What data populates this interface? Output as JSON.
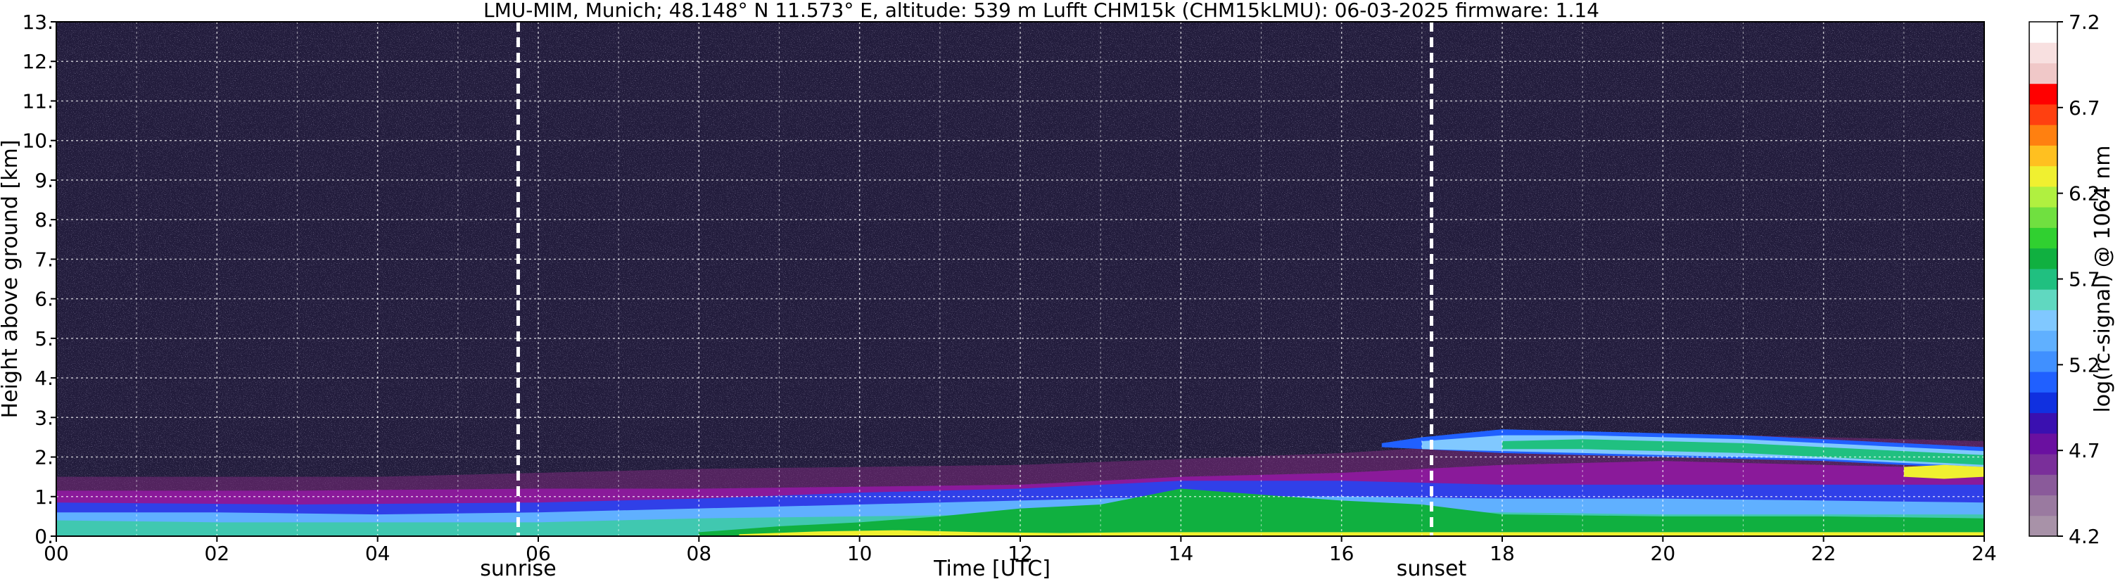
{
  "chart_data": {
    "type": "heatmap",
    "title": "LMU-MIM, Munich; 48.148° N 11.573° E, altitude: 539 m    Lufft CHM15k (CHM15kLMU): 06-03-2025    firmware: 1.14",
    "xlabel": "Time [UTC]",
    "ylabel": "Height above ground [km]",
    "xlim": [
      0,
      24
    ],
    "ylim": [
      0,
      13
    ],
    "x_ticks": [
      "00",
      "02",
      "04",
      "06",
      "08",
      "10",
      "12",
      "14",
      "16",
      "18",
      "20",
      "22",
      "24"
    ],
    "x_tick_values": [
      0,
      2,
      4,
      6,
      8,
      10,
      12,
      14,
      16,
      18,
      20,
      22,
      24
    ],
    "y_ticks": [
      "0.",
      "1.",
      "2.",
      "3.",
      "4.",
      "5.",
      "6.",
      "7.",
      "8.",
      "9.",
      "10.",
      "11.",
      "12.",
      "13."
    ],
    "y_tick_values": [
      0,
      1,
      2,
      3,
      4,
      5,
      6,
      7,
      8,
      9,
      10,
      11,
      12,
      13
    ],
    "grid": true,
    "background_color": "#221c3c",
    "colorbar": {
      "label": "log(rc-signal) @ 1064 nm",
      "range": [
        4.2,
        7.2
      ],
      "ticks": [
        "4.2",
        "4.7",
        "5.2",
        "5.7",
        "6.2",
        "6.7",
        "7.2"
      ],
      "tick_values": [
        4.2,
        4.7,
        5.2,
        5.7,
        6.2,
        6.7,
        7.2
      ],
      "colors": [
        "#a892a8",
        "#9a7aa0",
        "#8a5a9a",
        "#7a2f9a",
        "#6a10a0",
        "#3a10b0",
        "#1030e0",
        "#2060ff",
        "#4090ff",
        "#60b0ff",
        "#80c8ff",
        "#60d8c0",
        "#20c080",
        "#10b040",
        "#30d030",
        "#70e040",
        "#b0f040",
        "#f0f030",
        "#ffc020",
        "#ff8010",
        "#ff4010",
        "#ff0000",
        "#f0c8c8",
        "#f8e0e0",
        "#ffffff"
      ]
    },
    "events": [
      {
        "name": "sunrise",
        "time": 5.75
      },
      {
        "name": "sunset",
        "time": 17.12
      }
    ],
    "layers": [
      {
        "name": "noise-haze",
        "color": "#7a2a7a",
        "opacity": 0.55,
        "x": [
          0,
          4,
          8,
          12,
          16,
          20,
          24
        ],
        "bottom": [
          0,
          0,
          0,
          0,
          0,
          0,
          0
        ],
        "top": [
          1.5,
          1.5,
          1.7,
          1.8,
          2.1,
          2.6,
          2.4
        ]
      },
      {
        "name": "residual-layer",
        "color": "#8a1a9a",
        "opacity": 1,
        "x": [
          0,
          3,
          6,
          8,
          10,
          12,
          14,
          16,
          18,
          20,
          22,
          24
        ],
        "bottom": [
          0.7,
          0.7,
          0.7,
          0.8,
          1.0,
          1.0,
          1.0,
          1.0,
          1.0,
          1.0,
          1.0,
          1.0
        ],
        "top": [
          1.15,
          1.15,
          1.2,
          1.2,
          1.25,
          1.3,
          1.5,
          1.6,
          1.8,
          1.9,
          1.8,
          1.7
        ]
      },
      {
        "name": "mixing-blue",
        "color": "#3040e8",
        "opacity": 1,
        "x": [
          0,
          3,
          6,
          8,
          10,
          12,
          14,
          16,
          18,
          20,
          22,
          24
        ],
        "bottom": [
          0.35,
          0.35,
          0.35,
          0.4,
          0.4,
          0.5,
          0.6,
          0.6,
          0.6,
          0.6,
          0.6,
          0.6
        ],
        "top": [
          0.85,
          0.8,
          0.85,
          0.95,
          1.1,
          1.2,
          1.4,
          1.4,
          1.3,
          1.3,
          1.3,
          1.3
        ]
      },
      {
        "name": "aerosol-lightblue",
        "color": "#60b0ff",
        "opacity": 1,
        "x": [
          0,
          2,
          4,
          6,
          8,
          10,
          12,
          14,
          16,
          18,
          20,
          22,
          24
        ],
        "bottom": [
          0.25,
          0.25,
          0.25,
          0.25,
          0.25,
          0.3,
          0.35,
          0.4,
          0.4,
          0.4,
          0.4,
          0.4,
          0.4
        ],
        "top": [
          0.6,
          0.6,
          0.55,
          0.6,
          0.7,
          0.8,
          0.9,
          1.0,
          1.0,
          0.95,
          0.95,
          0.9,
          0.85
        ]
      },
      {
        "name": "surface-teal",
        "color": "#40c8b0",
        "opacity": 1,
        "x": [
          0,
          2,
          4,
          6,
          8,
          10,
          12,
          14,
          16,
          18,
          20,
          22,
          24
        ],
        "bottom": [
          0,
          0,
          0,
          0,
          0,
          0,
          0,
          0,
          0,
          0,
          0,
          0,
          0
        ],
        "top": [
          0.4,
          0.35,
          0.35,
          0.35,
          0.45,
          0.5,
          0.55,
          0.6,
          0.6,
          0.6,
          0.55,
          0.55,
          0.55
        ]
      },
      {
        "name": "growth-green",
        "color": "#10b040",
        "opacity": 1,
        "x": [
          8,
          9,
          10,
          11,
          12,
          13,
          14,
          15,
          16,
          17,
          18,
          20,
          22,
          24
        ],
        "bottom": [
          0,
          0,
          0,
          0,
          0,
          0,
          0,
          0,
          0,
          0,
          0,
          0,
          0,
          0
        ],
        "top": [
          0.1,
          0.25,
          0.35,
          0.5,
          0.7,
          0.8,
          1.2,
          1.05,
          0.9,
          0.8,
          0.55,
          0.5,
          0.5,
          0.45
        ]
      },
      {
        "name": "surface-yellow",
        "color": "#f0f030",
        "opacity": 1,
        "x": [
          8.5,
          9.5,
          10.5,
          11.5,
          12.5,
          13.5,
          14.5,
          16,
          18,
          20,
          22,
          24
        ],
        "bottom": [
          0,
          0,
          0,
          0,
          0,
          0,
          0,
          0,
          0,
          0,
          0,
          0
        ],
        "top": [
          0.05,
          0.12,
          0.15,
          0.1,
          0.08,
          0.1,
          0.1,
          0.1,
          0.1,
          0.1,
          0.1,
          0.1
        ]
      },
      {
        "name": "elevated-blue",
        "color": "#2060ff",
        "opacity": 1,
        "x": [
          16.5,
          17,
          18,
          19,
          20,
          21,
          22,
          23,
          24
        ],
        "bottom": [
          2.25,
          2.2,
          2.1,
          2.05,
          2.0,
          1.95,
          1.9,
          1.8,
          1.7
        ],
        "top": [
          2.35,
          2.5,
          2.7,
          2.65,
          2.6,
          2.55,
          2.45,
          2.35,
          2.25
        ]
      },
      {
        "name": "elevated-lightblue",
        "color": "#80c8ff",
        "opacity": 1,
        "x": [
          17,
          18,
          19,
          20,
          21,
          22,
          23,
          24
        ],
        "bottom": [
          2.2,
          2.15,
          2.1,
          2.05,
          2.0,
          1.95,
          1.85,
          1.75
        ],
        "top": [
          2.4,
          2.55,
          2.55,
          2.5,
          2.45,
          2.35,
          2.25,
          2.15
        ]
      },
      {
        "name": "elevated-green",
        "color": "#20c080",
        "opacity": 1,
        "x": [
          18,
          19,
          20,
          21,
          22,
          23,
          24
        ],
        "bottom": [
          2.2,
          2.2,
          2.15,
          2.1,
          2.0,
          1.9,
          1.8
        ],
        "top": [
          2.4,
          2.45,
          2.4,
          2.35,
          2.25,
          2.15,
          2.05
        ]
      },
      {
        "name": "elevated-yellow",
        "color": "#f0f030",
        "opacity": 1,
        "x": [
          23,
          23.5,
          24
        ],
        "bottom": [
          1.5,
          1.45,
          1.5
        ],
        "top": [
          1.75,
          1.8,
          1.75
        ]
      }
    ]
  }
}
